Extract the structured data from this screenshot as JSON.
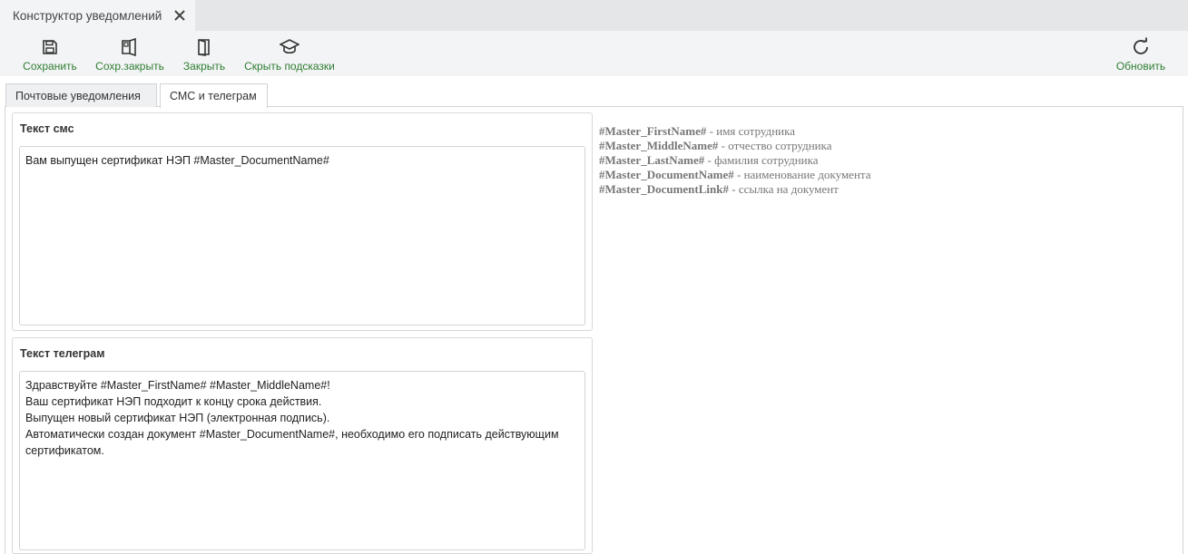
{
  "window": {
    "tab_title": "Конструктор уведомлений"
  },
  "toolbar": {
    "save": "Сохранить",
    "save_close": "Сохр.закрыть",
    "close": "Закрыть",
    "hide_hints": "Скрыть подсказки",
    "refresh": "Обновить",
    "accent_color": "#2e7d32"
  },
  "tabs": [
    {
      "label": "Почтовые уведомления",
      "active": false
    },
    {
      "label": "СМС и телеграм",
      "active": true
    }
  ],
  "sms": {
    "title": "Текст смс",
    "value": "Вам выпущен сертификат НЭП #Master_DocumentName#"
  },
  "telegram": {
    "title": "Текст телеграм",
    "value": "Здравствуйте #Master_FirstName# #Master_MiddleName#!\nВаш сертификат НЭП подходит к концу срока действия.\nВыпущен новый сертификат НЭП (электронная подпись).\nАвтоматически создан документ #Master_DocumentName#, необходимо его подписать действующим сертификатом."
  },
  "hints": [
    {
      "token": "#Master_FirstName#",
      "desc": " - имя сотрудника"
    },
    {
      "token": "#Master_MiddleName#",
      "desc": " - отчество сотрудника"
    },
    {
      "token": "#Master_LastName#",
      "desc": " - фамилия сотрудника"
    },
    {
      "token": "#Master_DocumentName#",
      "desc": " - наименование документа"
    },
    {
      "token": "#Master_DocumentLink#",
      "desc": " - ссылка на документ"
    }
  ]
}
